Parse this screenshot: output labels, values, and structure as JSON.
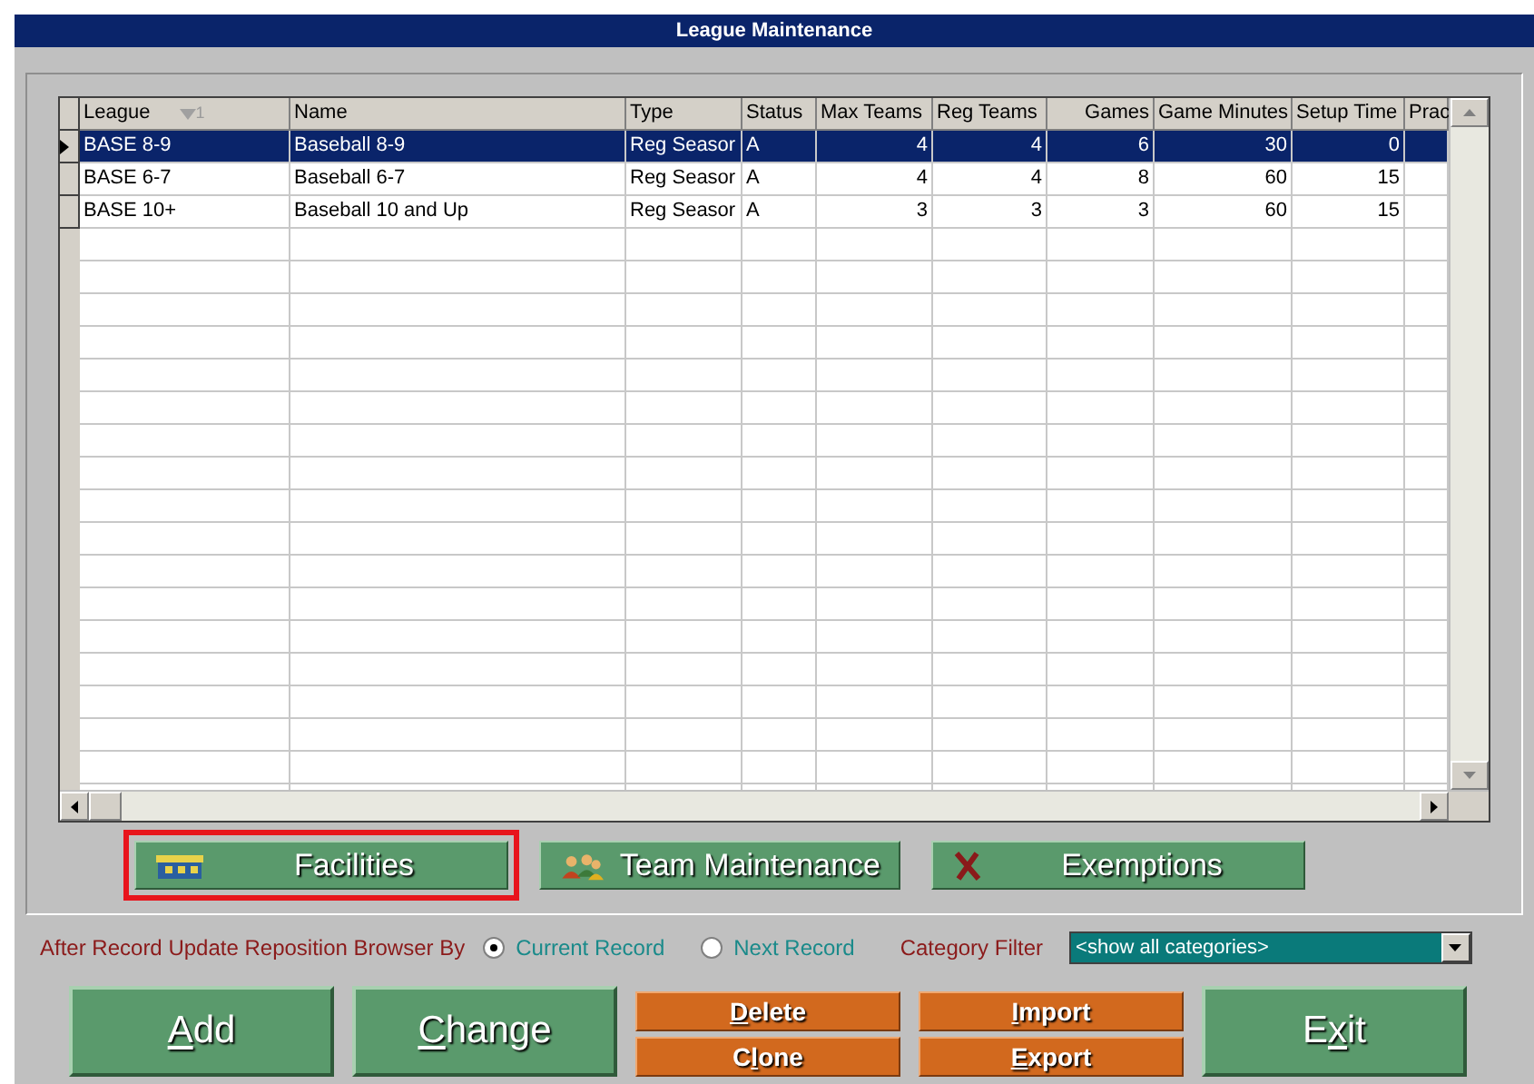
{
  "window": {
    "title": "League Maintenance"
  },
  "table": {
    "columns": [
      {
        "label": "League",
        "sort_order": "1",
        "kind": "text"
      },
      {
        "label": "Name",
        "kind": "text"
      },
      {
        "label": "Type",
        "kind": "text"
      },
      {
        "label": "Status",
        "kind": "text"
      },
      {
        "label": "Max Teams",
        "kind": "number"
      },
      {
        "label": "Reg Teams",
        "kind": "number"
      },
      {
        "label": "Games",
        "kind": "number"
      },
      {
        "label": "Game Minutes",
        "kind": "number"
      },
      {
        "label": "Setup Time",
        "kind": "number"
      },
      {
        "label": "Prac",
        "kind": "number"
      }
    ],
    "rows": [
      {
        "selected": true,
        "cells": [
          "BASE 8-9",
          "Baseball 8-9",
          "Reg Seasor",
          "A",
          "4",
          "4",
          "6",
          "30",
          "0",
          null
        ]
      },
      {
        "selected": false,
        "cells": [
          "BASE 6-7",
          "Baseball 6-7",
          "Reg Seasor",
          "A",
          "4",
          "4",
          "8",
          "60",
          "15",
          null
        ]
      },
      {
        "selected": false,
        "cells": [
          "BASE 10+",
          "Baseball 10 and Up",
          "Reg Seasor",
          "A",
          "3",
          "3",
          "3",
          "60",
          "15",
          null
        ]
      }
    ]
  },
  "tool_buttons": [
    {
      "kind": "facilities",
      "label": "Facilities",
      "highlighted": true
    },
    {
      "kind": "team",
      "label": "Team Maintenance",
      "highlighted": false
    },
    {
      "kind": "exemptions",
      "label": "Exemptions",
      "highlighted": false
    }
  ],
  "reposition": {
    "label": "After Record Update Reposition Browser By",
    "options": [
      {
        "label": "Current Record",
        "selected": true
      },
      {
        "label": "Next Record",
        "selected": false
      }
    ]
  },
  "category_filter": {
    "label": "Category Filter",
    "value": "<show all categories>"
  },
  "buttons": [
    {
      "kind": "big",
      "key": "A",
      "post": "dd"
    },
    {
      "kind": "big",
      "key": "C",
      "post": "hange"
    },
    {
      "kind": "pair",
      "items": [
        {
          "key": "D",
          "post": "elete"
        },
        {
          "pre": "C",
          "key": "l",
          "post": "one"
        }
      ]
    },
    {
      "kind": "pair",
      "items": [
        {
          "key": "I",
          "post": "mport"
        },
        {
          "key": "E",
          "post": "xport"
        }
      ]
    },
    {
      "kind": "big",
      "pre": "E",
      "key": "x",
      "post": "it"
    }
  ]
}
